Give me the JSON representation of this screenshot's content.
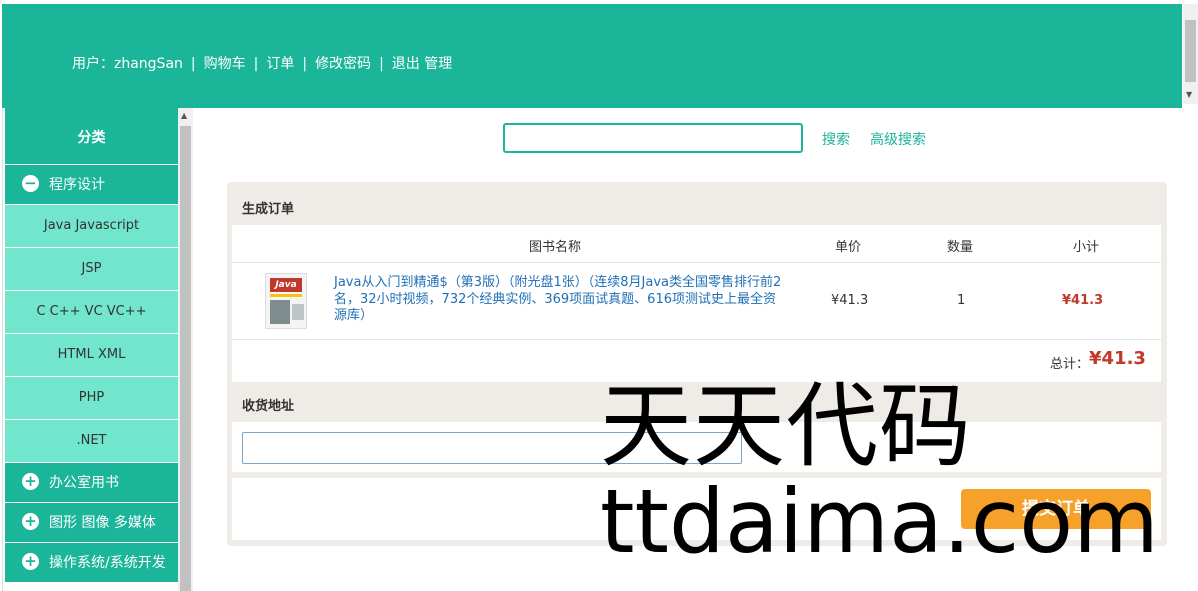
{
  "header": {
    "nav": [
      "用户：zhangSan",
      "购物车",
      "订单",
      "修改密码",
      "退出",
      "管理"
    ],
    "separator": "|"
  },
  "sidebar": {
    "title": "分类",
    "groups": [
      {
        "label": "程序设计",
        "expanded": true,
        "items": [
          "Java Javascript",
          "JSP",
          "C C++ VC VC++",
          "HTML XML",
          "PHP",
          ".NET"
        ]
      },
      {
        "label": "办公室用书",
        "expanded": false
      },
      {
        "label": "图形 图像 多媒体",
        "expanded": false
      },
      {
        "label": "操作系统/系统开发",
        "expanded": false
      }
    ]
  },
  "search": {
    "placeholder": "",
    "search_label": "搜索",
    "advanced_label": "高级搜索"
  },
  "order": {
    "title": "生成订单",
    "columns": [
      "图书名称",
      "单价",
      "数量",
      "小计"
    ],
    "items": [
      {
        "cover_text": "Java",
        "name": "Java从入门到精通$（第3版）（附光盘1张）（连续8月Java类全国零售排行前2名，32小时视频，732个经典实例、369项面试真题、616项测试史上最全资源库）",
        "price": "¥41.3",
        "quantity": "1",
        "subtotal": "¥41.3"
      }
    ],
    "total_label": "总计：",
    "total_value": "¥41.3"
  },
  "address": {
    "title": "收货地址",
    "value": ""
  },
  "submit_label": "提交订单",
  "watermark": {
    "line1": "天天代码",
    "line2": "ttdaima.com"
  },
  "colors": {
    "brand": "#1bb59a",
    "sidebar_item": "#72e5cd",
    "price": "#c0392b",
    "submit": "#f5a12a"
  }
}
